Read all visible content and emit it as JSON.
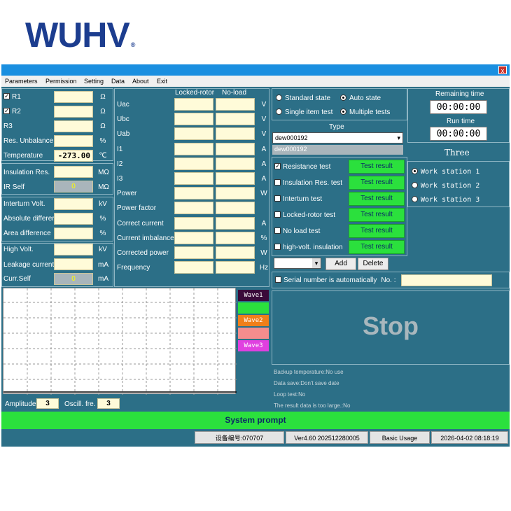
{
  "logo": {
    "text": "WUHV",
    "mark": "®"
  },
  "window": {
    "close_label": "x"
  },
  "menu": [
    "Parameters",
    "Permission",
    "Setting",
    "Data",
    "About",
    "Exit"
  ],
  "resistance": {
    "r1": {
      "label": "R1",
      "checked": true,
      "unit": "Ω"
    },
    "r2": {
      "label": "R2",
      "checked": true,
      "unit": "Ω"
    },
    "r3": {
      "label": "R3",
      "unit": "Ω"
    },
    "unbalance": {
      "label": "Res. Unbalance",
      "unit": "%"
    },
    "temperature": {
      "label": "Temperature",
      "value": "-273.00",
      "unit": "℃"
    }
  },
  "insulation": {
    "res": {
      "label": "Insulation Res.",
      "unit": "MΩ"
    },
    "self": {
      "label": "IR Self",
      "value": "0",
      "unit": "MΩ"
    }
  },
  "interturn": {
    "volt": {
      "label": "Interturn Volt.",
      "unit": "kV"
    },
    "absdiff": {
      "label": "Absolute differer",
      "unit": "%"
    },
    "areadiff": {
      "label": "Area difference",
      "unit": "%"
    }
  },
  "highvolt": {
    "volt": {
      "label": "High Volt.",
      "unit": "kV"
    },
    "leak": {
      "label": "Leakage current",
      "unit": "mA"
    },
    "self": {
      "label": "Curr.Self",
      "value": "0",
      "unit": "mA"
    }
  },
  "measure": {
    "col1": "Locked-rotor",
    "col2": "No-load",
    "rows": [
      {
        "label": "Uac",
        "unit": "V"
      },
      {
        "label": "Ubc",
        "unit": "V"
      },
      {
        "label": "Uab",
        "unit": "V"
      },
      {
        "label": "I1",
        "unit": "A"
      },
      {
        "label": "I2",
        "unit": "A"
      },
      {
        "label": "I3",
        "unit": "A"
      },
      {
        "label": "Power",
        "unit": "W"
      },
      {
        "label": "Power factor",
        "unit": ""
      },
      {
        "label": "Correct current",
        "unit": "A"
      },
      {
        "label": "Current imbalance",
        "unit": "%"
      },
      {
        "label": "Corrected power",
        "unit": "W"
      },
      {
        "label": "Frequency",
        "unit": "Hz"
      }
    ]
  },
  "state": {
    "standard": "Standard state",
    "auto": "Auto state",
    "single": "Single item test",
    "multiple": "Multiple tests",
    "selected_state": "auto",
    "selected_mode": "multiple"
  },
  "type": {
    "label": "Type",
    "selected": "dew000192",
    "list_item": "dew000192"
  },
  "tests": [
    {
      "label": "Resistance test",
      "checked": true,
      "result": "Test result"
    },
    {
      "label": "Insulation Res. test",
      "checked": false,
      "result": "Test result"
    },
    {
      "label": "Interturn test",
      "checked": false,
      "result": "Test result"
    },
    {
      "label": "Locked-rotor test",
      "checked": false,
      "result": "Test result"
    },
    {
      "label": "No load test",
      "checked": false,
      "result": "Test result"
    },
    {
      "label": "high-volt. insulation",
      "checked": false,
      "result": "Test result"
    }
  ],
  "actions": {
    "add": "Add",
    "delete": "Delete"
  },
  "serial": {
    "label": "Serial number is automatically",
    "no_label": "No. :",
    "value": ""
  },
  "timers": {
    "remaining_label": "Remaining time",
    "remaining": "00:00:00",
    "run_label": "Run time",
    "run": "00:00:00"
  },
  "stations": {
    "title": "Three",
    "items": [
      "Work station 1",
      "Work station 2",
      "Work station 3"
    ],
    "selected": 0
  },
  "waves": [
    {
      "label": "Wave1",
      "color": "#3a0a3a"
    },
    {
      "label": "",
      "color": "#2be03d"
    },
    {
      "label": "Wave2",
      "color": "#f07f1a"
    },
    {
      "label": "",
      "color": "#f58d8d"
    },
    {
      "label": "Wave3",
      "color": "#e040e0"
    }
  ],
  "scope": {
    "amplitude_label": "Amplitude",
    "amplitude": "3",
    "oscill_label": "Oscill. fre.",
    "oscill": "3"
  },
  "big_status": "Stop",
  "info": [
    "Backup temperature:No use",
    "Data save:Don't save date",
    "Loop test:No",
    "The result data is too large.:No"
  ],
  "system_prompt": "System prompt",
  "statusbar": {
    "device": "设备编号:070707",
    "version": "Ver4.60  202512280005",
    "mode": "Basic Usage",
    "datetime": "2026-04-02 08:18:19"
  }
}
